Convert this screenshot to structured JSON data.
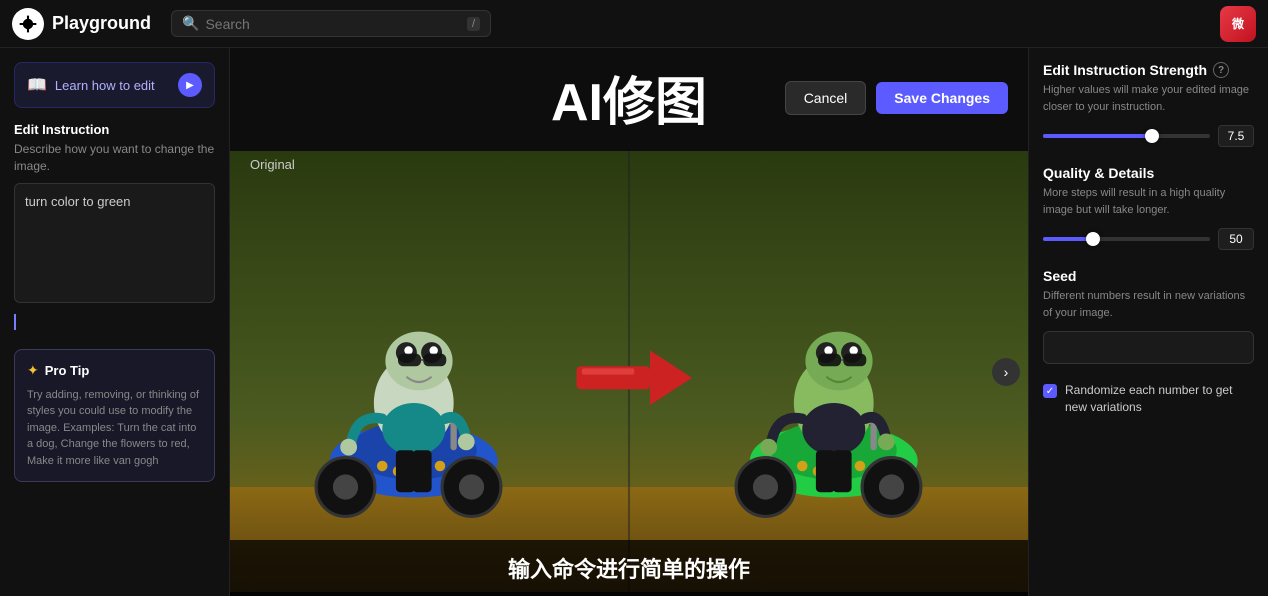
{
  "nav": {
    "logo_text": "Playground",
    "search_placeholder": "Search",
    "search_shortcut": "/",
    "avatar_emoji": "微"
  },
  "left_sidebar": {
    "learn_btn_label": "Learn how to edit",
    "edit_instruction_title": "Edit Instruction",
    "edit_instruction_desc": "Describe how you want to change the image.",
    "edit_instruction_value": "turn color to green",
    "pro_tip_title": "Pro Tip",
    "pro_tip_text": "Try adding, removing, or thinking of styles you could use to modify the image. Examples: Turn the cat into a dog, Change the flowers to red, Make it more like van gogh"
  },
  "center": {
    "title": "AI修图",
    "cancel_label": "Cancel",
    "save_label": "Save Changes",
    "original_label": "Original",
    "subtitle": "输入命令进行简单的操作"
  },
  "right_sidebar": {
    "strength_title": "Edit Instruction Strength",
    "strength_desc": "Higher values will make your edited image closer to your instruction.",
    "strength_value": "7.5",
    "strength_percent": 65,
    "quality_title": "Quality & Details",
    "quality_desc": "More steps will result in a high quality image but will take longer.",
    "quality_value": "50",
    "quality_percent": 30,
    "seed_title": "Seed",
    "seed_desc": "Different numbers result in new variations of your image.",
    "seed_placeholder": "",
    "randomize_label": "Randomize each number to get new variations"
  }
}
